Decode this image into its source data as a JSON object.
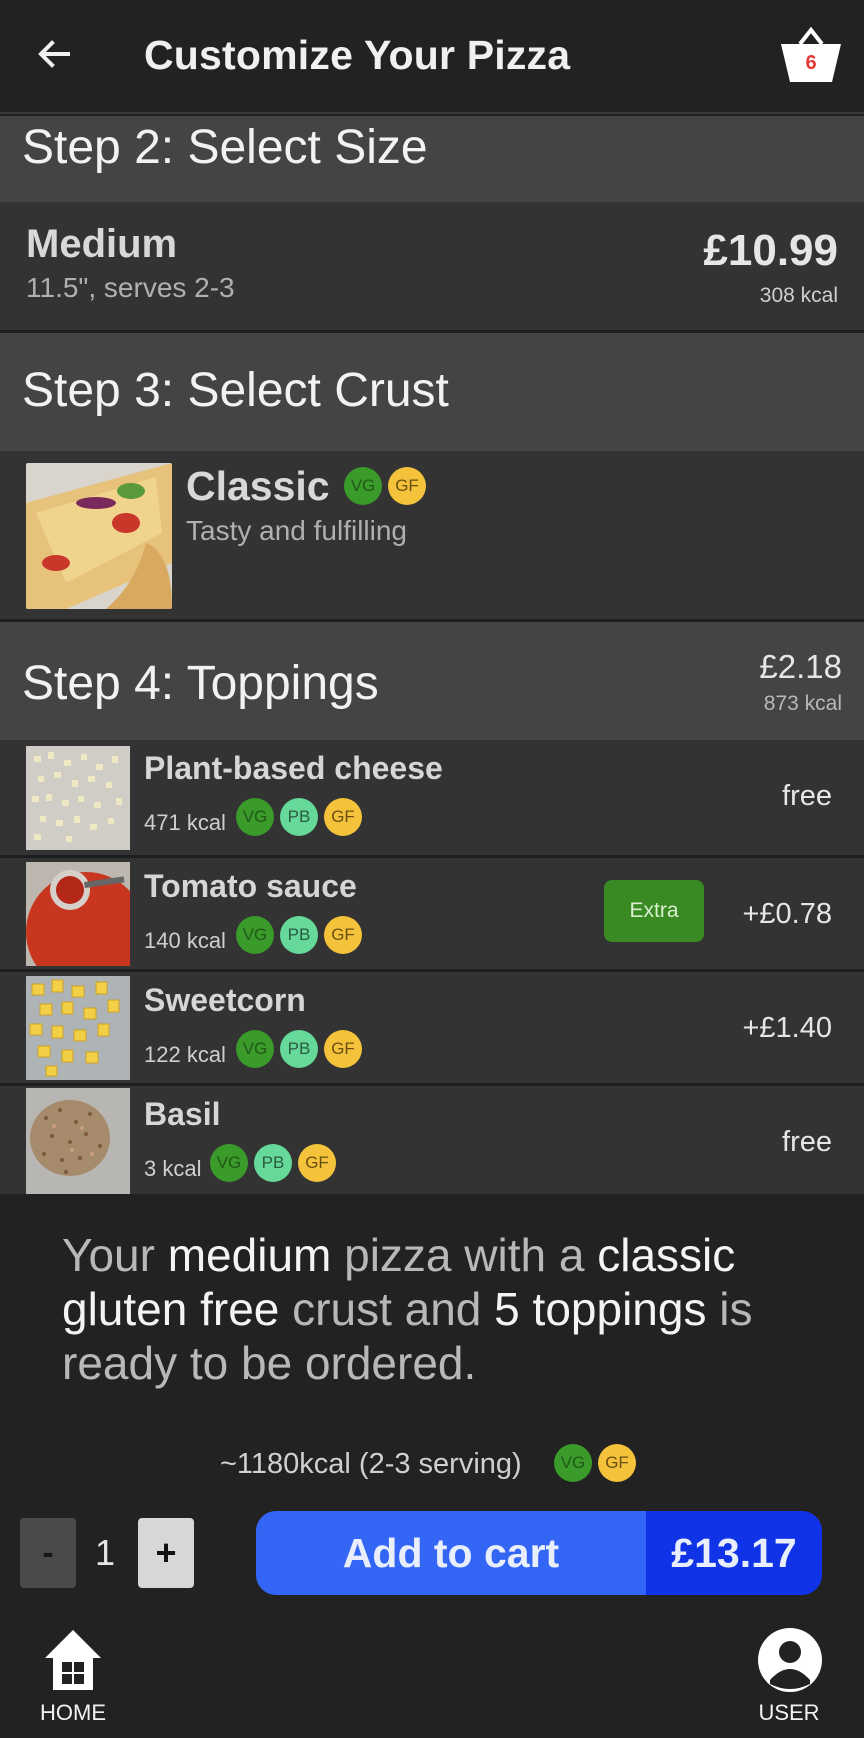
{
  "appbar": {
    "title": "Customize Your Pizza",
    "basket_count": "6"
  },
  "size": {
    "header": "Step 2: Select Size",
    "name": "Medium",
    "desc": "11.5\", serves 2-3",
    "price": "£10.99",
    "kcal": "308 kcal"
  },
  "crust": {
    "header": "Step 3: Select Crust",
    "name": "Classic",
    "desc": "Tasty and fulfilling",
    "badges": [
      "VG",
      "GF"
    ]
  },
  "toppings": {
    "header": "Step 4: Toppings",
    "price": "£2.18",
    "kcal": "873 kcal",
    "items": [
      {
        "name": "Plant-based cheese",
        "kcal": "471 kcal",
        "badges": [
          "VG",
          "PB",
          "GF"
        ],
        "price": "free"
      },
      {
        "name": "Tomato sauce",
        "kcal": "140 kcal",
        "badges": [
          "VG",
          "PB",
          "GF"
        ],
        "price": "+£0.78",
        "extra": "Extra"
      },
      {
        "name": "Sweetcorn",
        "kcal": "122 kcal",
        "badges": [
          "VG",
          "PB",
          "GF"
        ],
        "price": "+£1.40"
      },
      {
        "name": "Basil",
        "kcal": "3 kcal",
        "badges": [
          "VG",
          "PB",
          "GF"
        ],
        "price": "free"
      }
    ]
  },
  "summary": {
    "p1": "Your ",
    "size": "medium",
    "p2": " pizza with a ",
    "crust": "classic gluten free",
    "p3": " crust and ",
    "count": "5 toppings",
    "p4": " is ready to be ordered."
  },
  "totals": {
    "kcal": "~1180kcal (2-3 serving)",
    "badges": [
      "VG",
      "GF"
    ]
  },
  "quantity": {
    "minus": "-",
    "value": "1",
    "plus": "+"
  },
  "cart": {
    "label": "Add to cart",
    "price": "£13.17"
  },
  "nav": {
    "home": "HOME",
    "user": "USER"
  },
  "colors": {
    "vg": "#3a9a2a",
    "pb": "#66d99a",
    "gf": "#f5c33b",
    "cart_primary": "#3366f5",
    "cart_price": "#1133e8",
    "extra": "#3a8a23"
  }
}
